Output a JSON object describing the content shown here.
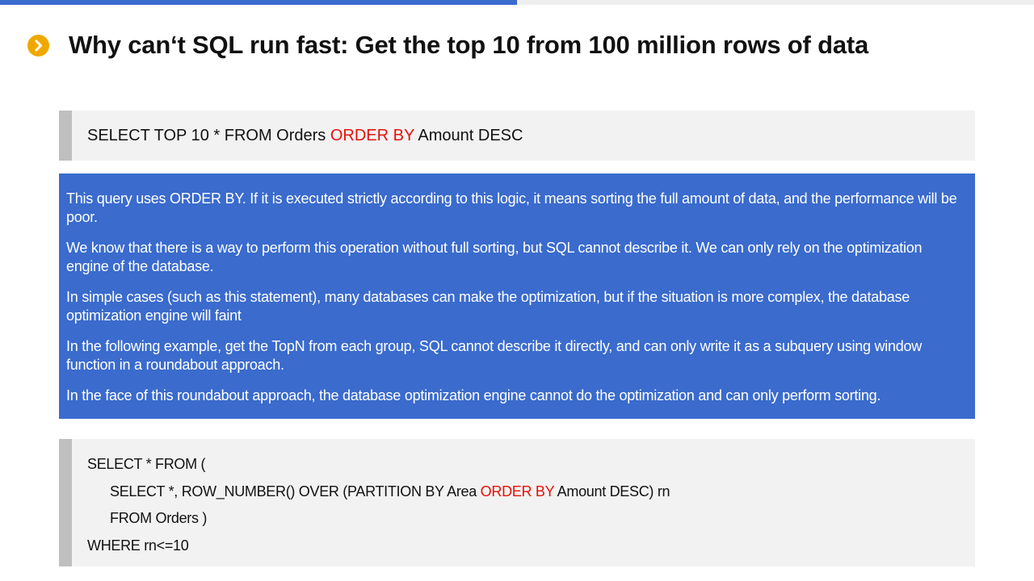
{
  "progress": {
    "fraction": 0.5,
    "color": "#3a6bcd"
  },
  "title": "Why can‘t SQL run fast: Get the top 10 from 100 million rows of data",
  "query_top": {
    "before": "SELECT TOP 10 * FROM Orders ",
    "keyword": "ORDER BY",
    "after": " Amount DESC"
  },
  "explanation": [
    "This query uses ORDER BY. If it is executed strictly according to this logic, it means sorting the full amount of data, and the performance will be poor.",
    "We know that there is a way to perform this operation without full sorting, but SQL cannot describe it. We can only rely on the optimization engine of the database.",
    "In simple cases (such as this statement), many databases can make the optimization, but if the situation is more complex, the database optimization engine will faint",
    "In the following example, get the TopN from each group, SQL cannot describe it directly, and can only write it as a subquery using window function in a roundabout approach.",
    "In the face of this roundabout approach, the database optimization engine cannot do the optimization and can only perform sorting."
  ],
  "query_bottom": {
    "line1": "SELECT * FROM (",
    "line2_before": "SELECT *, ROW_NUMBER() OVER (PARTITION BY Area ",
    "line2_keyword": "ORDER BY",
    "line2_after": " Amount DESC) rn",
    "line3": "FROM Orders )",
    "line4": "WHERE rn<=10"
  },
  "colors": {
    "accent_blue": "#3a6bcd",
    "bullet_orange": "#f0a800",
    "keyword_red": "#e3120b",
    "code_bg": "#f2f2f2",
    "code_bar": "#bfbfbf"
  },
  "icons": {
    "bullet": "chevron-right-circle-icon"
  }
}
